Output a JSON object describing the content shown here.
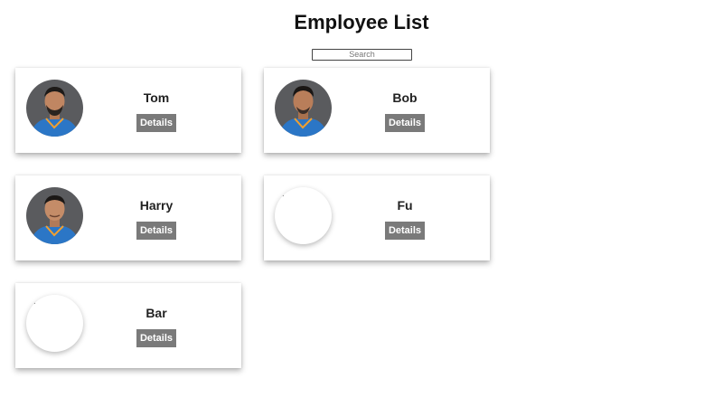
{
  "header": {
    "title": "Employee List"
  },
  "search": {
    "placeholder": "Search",
    "value": ""
  },
  "employees": [
    {
      "name": "Tom",
      "button_label": "Details",
      "avatar": "photo"
    },
    {
      "name": "Bob",
      "button_label": "Details",
      "avatar": "photo"
    },
    {
      "name": "Harry",
      "button_label": "Details",
      "avatar": "photo"
    },
    {
      "name": "Fu",
      "button_label": "Details",
      "avatar": "broken-image"
    },
    {
      "name": "Bar",
      "button_label": "Details",
      "avatar": "broken-image"
    }
  ],
  "colors": {
    "button_bg": "#7a7a7a",
    "button_text": "#ffffff",
    "jersey_blue": "#2b76c6",
    "photo_bg": "#5a5b5e"
  }
}
